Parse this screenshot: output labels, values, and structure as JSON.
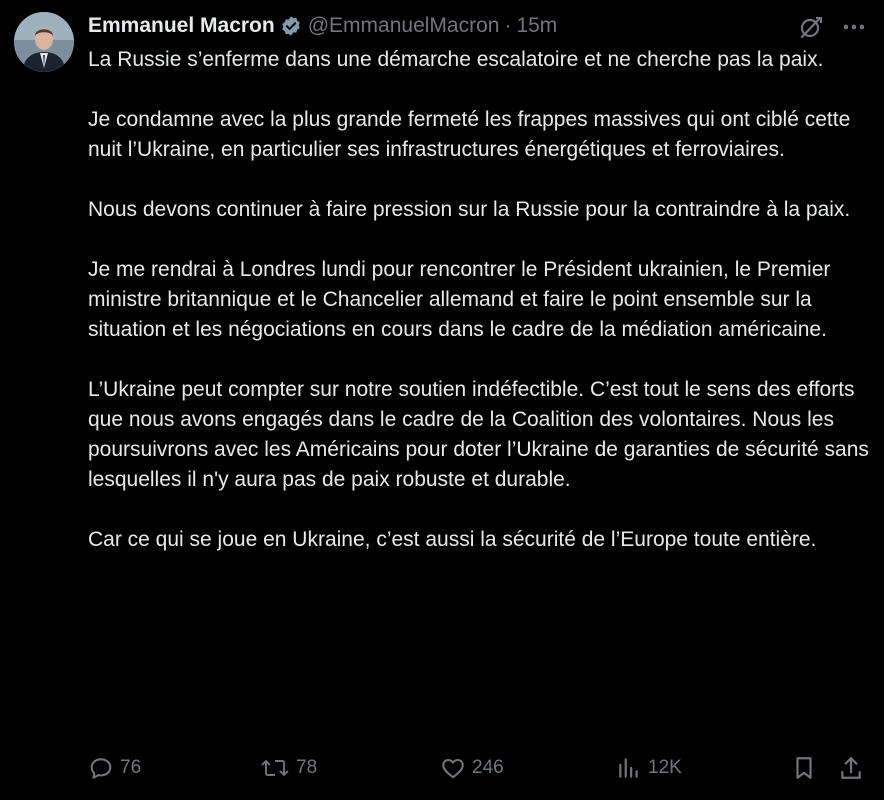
{
  "author": {
    "display_name": "Emmanuel Macron",
    "handle": "@EmmanuelMacron",
    "separator": "·",
    "time": "15m",
    "avatar_icon": "profile-photo"
  },
  "colors": {
    "background": "#000000",
    "text": "#e7e9ea",
    "secondary": "#71767b",
    "verified_badge": "#829aab"
  },
  "tweet": {
    "paragraphs": [
      "La Russie s’enferme dans une démarche escalatoire et ne cherche pas la paix.",
      "Je condamne avec la plus grande fermeté les frappes massives qui ont ciblé cette nuit l’Ukraine, en particulier ses infrastructures énergétiques et ferroviaires.",
      "Nous devons continuer à faire pression sur la Russie pour la contraindre à la paix.",
      "Je me rendrai à Londres lundi pour rencontrer le Président ukrainien, le Premier ministre britannique et le Chancelier allemand et faire le point ensemble sur la situation et les négociations en cours dans le cadre de la médiation américaine.",
      "L’Ukraine peut compter sur notre soutien indéfectible. C’est tout le sens des efforts que nous avons engagés dans le cadre de la Coalition des volontaires. Nous les poursuivrons avec les Américains pour doter l’Ukraine de garanties de sécurité sans lesquelles il n'y aura pas de paix robuste et durable.",
      "Car ce qui se joue en Ukraine, c’est aussi la sécurité de l’Europe toute entière."
    ]
  },
  "actions": {
    "replies": "76",
    "reposts": "78",
    "likes": "246",
    "views": "12K"
  },
  "icons": {
    "verified": "verified-badge-icon",
    "grok": "grok-icon",
    "more": "more-icon",
    "reply": "reply-icon",
    "repost": "repost-icon",
    "like": "like-icon",
    "views": "views-icon",
    "bookmark": "bookmark-icon",
    "share": "share-icon"
  }
}
